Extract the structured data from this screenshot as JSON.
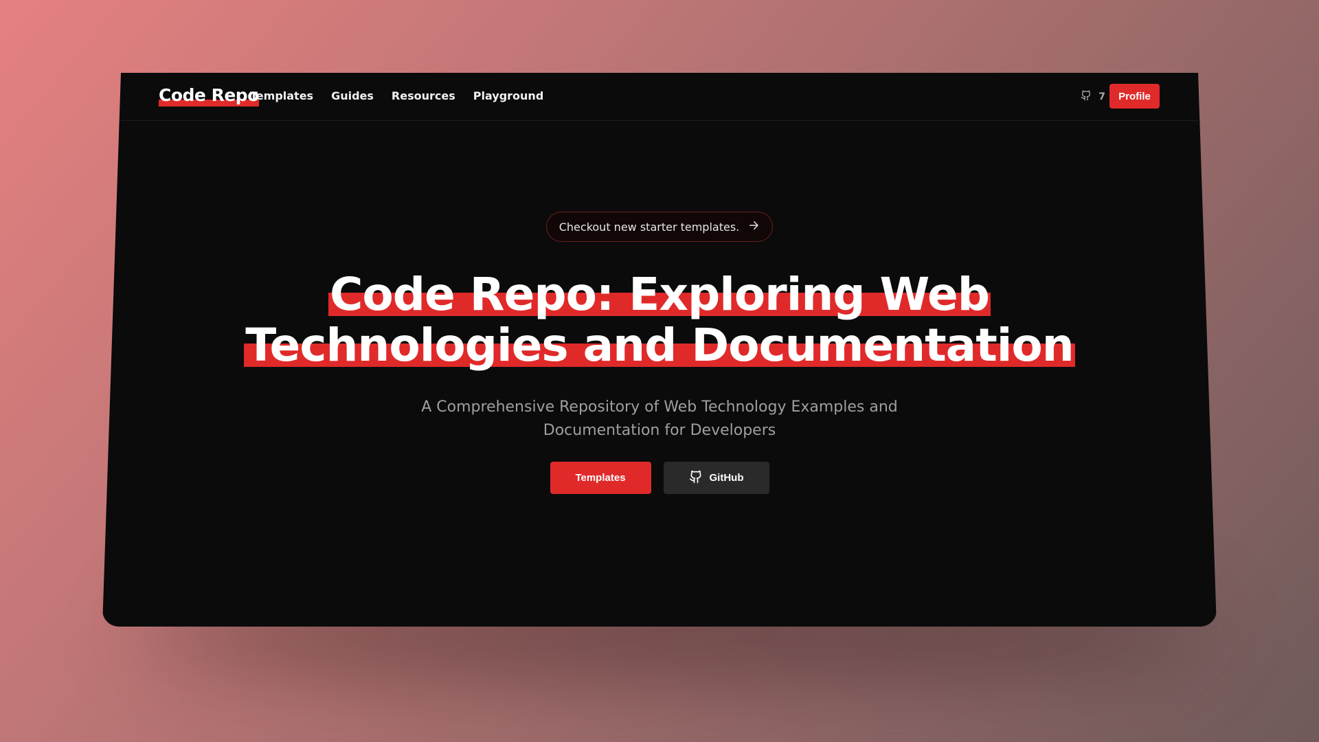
{
  "brand": {
    "logo_text": "Code Repo"
  },
  "nav": {
    "items": [
      {
        "label": "Templates"
      },
      {
        "label": "Guides"
      },
      {
        "label": "Resources"
      },
      {
        "label": "Playground"
      }
    ],
    "github_stars": "7",
    "profile_label": "Profile"
  },
  "announcement": {
    "text": "Checkout new starter templates.",
    "icon": "arrow-right-icon"
  },
  "hero": {
    "line1": "Code Repo: Exploring Web",
    "line2": "Technologies and Documentation",
    "subtitle_line1": "A Comprehensive Repository of Web Technology Examples and",
    "subtitle_line2": "Documentation for Developers"
  },
  "actions": {
    "primary_label": "Templates",
    "secondary_label": "GitHub",
    "secondary_icon": "github-icon"
  },
  "colors": {
    "accent": "#e02a2a",
    "surface": "#0b0b0b",
    "button_dark": "#2a2a2a"
  }
}
